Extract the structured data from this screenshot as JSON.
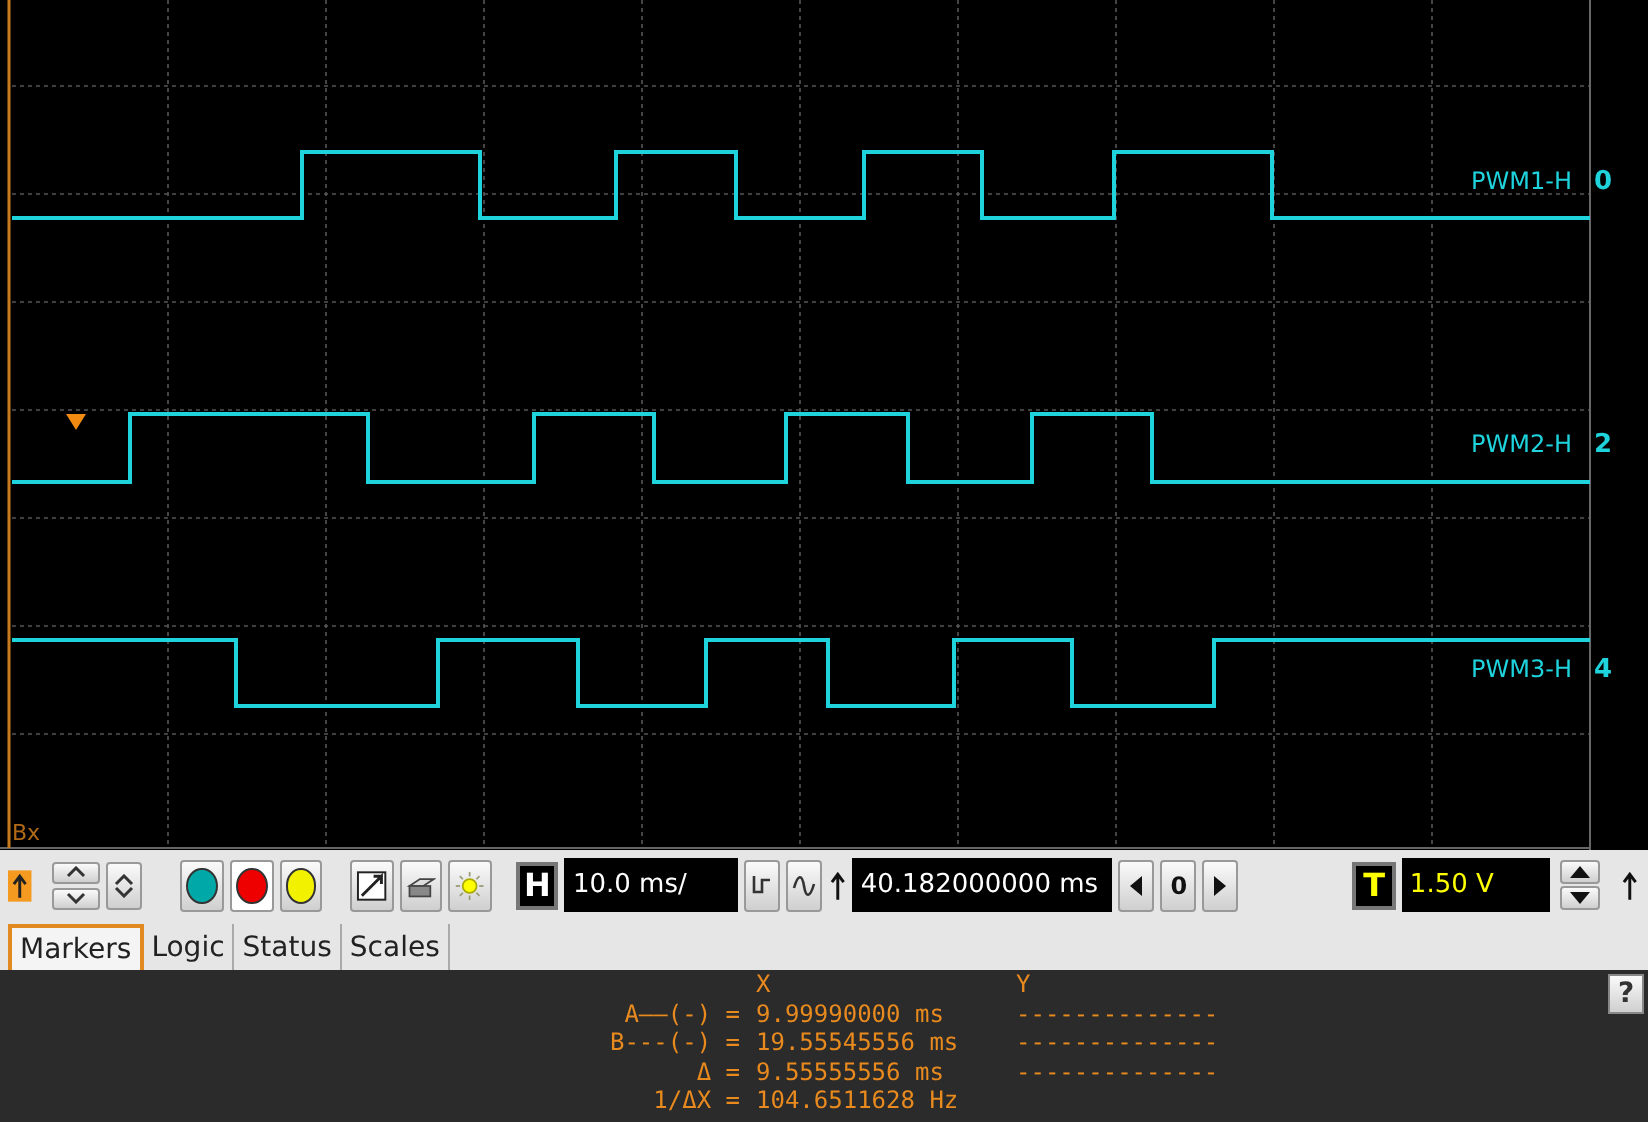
{
  "scope": {
    "marker_label": "Bx",
    "channels": [
      {
        "name": "PWM1-H",
        "number": "0",
        "color": "#1ed3dc"
      },
      {
        "name": "PWM2-H",
        "number": "2",
        "color": "#1ed3dc"
      },
      {
        "name": "PWM3-H",
        "number": "4",
        "color": "#1ed3dc"
      }
    ]
  },
  "toolbar": {
    "color_buttons": [
      {
        "color": "#00a8a8",
        "selected": false
      },
      {
        "color": "#ee0000",
        "selected": true
      },
      {
        "color": "#f2f200",
        "selected": false
      }
    ],
    "h_key": "H",
    "timebase": "10.0 ms/",
    "position": "40.182000000 ms",
    "step": "0",
    "t_key": "T",
    "trigger_level": "1.50 V"
  },
  "tabs": [
    {
      "label": "Markers",
      "selected": true
    },
    {
      "label": "Logic",
      "selected": false
    },
    {
      "label": "Status",
      "selected": false
    },
    {
      "label": "Scales",
      "selected": false
    }
  ],
  "markers": {
    "columns": [
      "X",
      "Y"
    ],
    "rows": [
      {
        "label": "A——(-) =",
        "x": "9.99990000 ms",
        "y": "--------------"
      },
      {
        "label": "B---(-) =",
        "x": "19.55545556 ms",
        "y": "--------------"
      },
      {
        "label": "Δ =",
        "x": "9.55555556 ms",
        "y": "--------------"
      },
      {
        "label": "1/ΔX =",
        "x": "104.6511628 Hz"
      }
    ]
  },
  "help": "?"
}
